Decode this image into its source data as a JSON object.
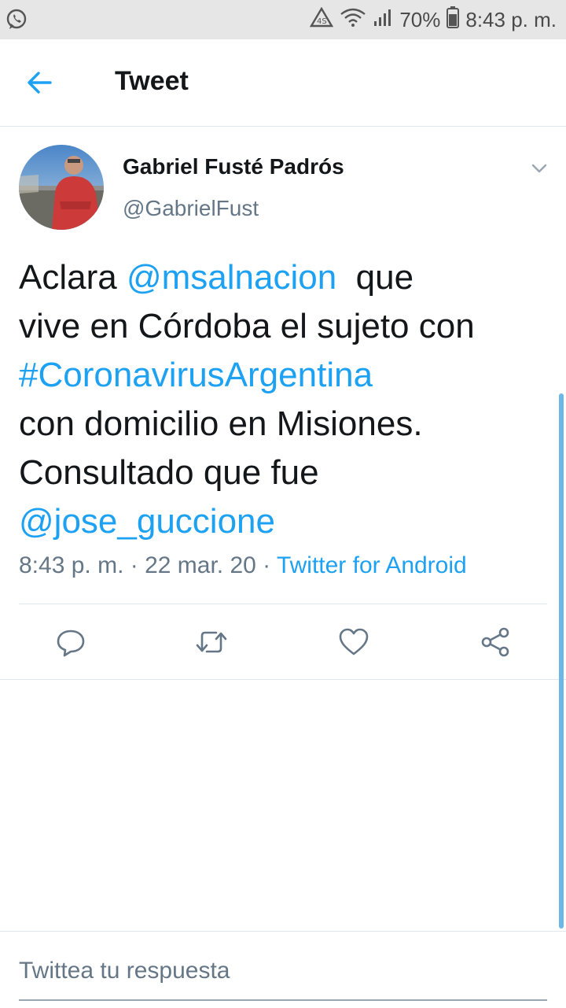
{
  "status_bar": {
    "battery": "70%",
    "time": "8:43 p. m.",
    "icons": [
      "whatsapp-icon",
      "data-saver-icon",
      "wifi-icon",
      "signal-icon",
      "battery-icon"
    ]
  },
  "header": {
    "title": "Tweet",
    "back_icon": "arrow-left-icon"
  },
  "tweet": {
    "author_name": "Gabriel Fusté Padrós",
    "author_handle": "@GabrielFust",
    "text": {
      "l1_a": "Aclara ",
      "l1_mention": "@msalnacion",
      "l1_b": "  que",
      "l2": "vive en Córdoba el sujeto con",
      "l3_hashtag": "#CoronavirusArgentina",
      "l4": "con domicilio en Misiones.",
      "l5": "Consultado que fue",
      "l6_mention": "@jose_guccione"
    },
    "timestamp": "8:43 p. m. · 22 mar. 20 · ",
    "source": "Twitter for Android"
  },
  "actions": [
    "reply-icon",
    "retweet-icon",
    "like-icon",
    "share-icon"
  ],
  "reply": {
    "placeholder": "Twittea tu respuesta"
  },
  "colors": {
    "accent": "#1da1f2",
    "secondary_text": "#657786",
    "primary_text": "#14171a",
    "status_bar_bg": "#e6e6e6"
  }
}
